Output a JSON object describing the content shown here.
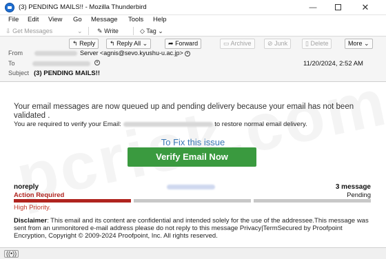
{
  "window": {
    "title": "(3) PENDING MAILS!! - Mozilla Thunderbird",
    "min_glyph": "—",
    "close_glyph": "✕"
  },
  "menu": [
    "File",
    "Edit",
    "View",
    "Go",
    "Message",
    "Tools",
    "Help"
  ],
  "toolbar": {
    "get_messages": "Get Messages",
    "write": "Write",
    "tag": "Tag"
  },
  "actions": {
    "reply": "Reply",
    "reply_all": "Reply All",
    "forward": "Forward",
    "archive": "Archive",
    "junk": "Junk",
    "delete": "Delete",
    "more": "More"
  },
  "header": {
    "from_label": "From",
    "from_value": "Server <agnis@sevo.kyushu-u.ac.jp>",
    "to_label": "To",
    "subject_label": "Subject",
    "subject": "(3) PENDING MAILS!!",
    "date": "11/20/2024, 2:52 AM"
  },
  "body": {
    "para1": "Your email messages are now queued up and pending delivery because your email has not been validated .",
    "para2_before": "You are required to verify your Email: ",
    "para2_after": " to restore normal email delivery.",
    "fix_title": "To Fix this issue",
    "verify_button": "Verify Email Now",
    "noreply": "noreply",
    "message_count": "3 message",
    "action_required": "Action Required",
    "pending": "Pending",
    "priority": "High Priority.",
    "disclaimer_label": "Disclaimer",
    "disclaimer_text": ": This email and its content are confidential and intended solely for the use of the addressee.This message was sent from an unmonitored e-mail address please do not reply to this message Privacy|TermSecured by Proofpoint Encryption, Copyright © 2009-2024 Proofpoint, Inc. All rights reserved."
  },
  "progress_segments": [
    {
      "color": "#b0241f",
      "state": "action-required"
    },
    {
      "color": "#c8c8c8",
      "state": "pending"
    },
    {
      "color": "#c8c8c8",
      "state": "pending"
    }
  ],
  "watermark": "pcrisk.com",
  "statusbar": {
    "icon": "((•))"
  }
}
